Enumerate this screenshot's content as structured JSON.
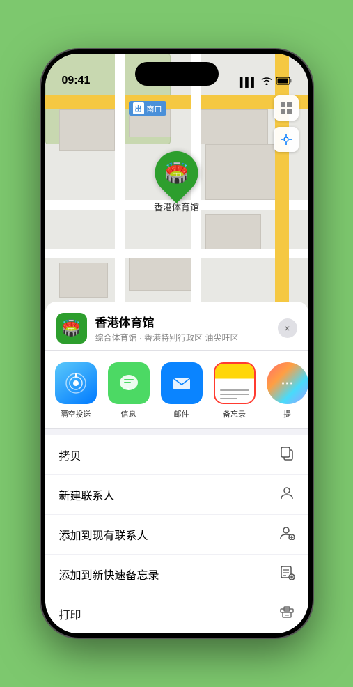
{
  "status_bar": {
    "time": "09:41",
    "signal_icon": "▌▌▌",
    "wifi_icon": "wifi",
    "battery_icon": "battery"
  },
  "map": {
    "entrance_label": "南口",
    "pin_label": "香港体育馆"
  },
  "venue_card": {
    "name": "香港体育馆",
    "description": "综合体育馆 · 香港特别行政区 油尖旺区",
    "close_label": "×"
  },
  "share_actions": [
    {
      "id": "airdrop",
      "label": "隔空投送",
      "icon_type": "airdrop"
    },
    {
      "id": "messages",
      "label": "信息",
      "icon_type": "messages"
    },
    {
      "id": "mail",
      "label": "邮件",
      "icon_type": "mail"
    },
    {
      "id": "notes",
      "label": "备忘录",
      "icon_type": "notes"
    },
    {
      "id": "more",
      "label": "提",
      "icon_type": "more"
    }
  ],
  "action_items": [
    {
      "id": "copy",
      "label": "拷贝",
      "icon": "📋"
    },
    {
      "id": "new-contact",
      "label": "新建联系人",
      "icon": "👤"
    },
    {
      "id": "add-existing",
      "label": "添加到现有联系人",
      "icon": "👤"
    },
    {
      "id": "add-quick-note",
      "label": "添加到新快速备忘录",
      "icon": "📝"
    },
    {
      "id": "print",
      "label": "打印",
      "icon": "🖨️"
    }
  ],
  "colors": {
    "green": "#2d9e2d",
    "blue": "#007aff",
    "red": "#ff3b30",
    "bg_light": "#f2f2f7",
    "bg_green": "#7dc86e"
  }
}
